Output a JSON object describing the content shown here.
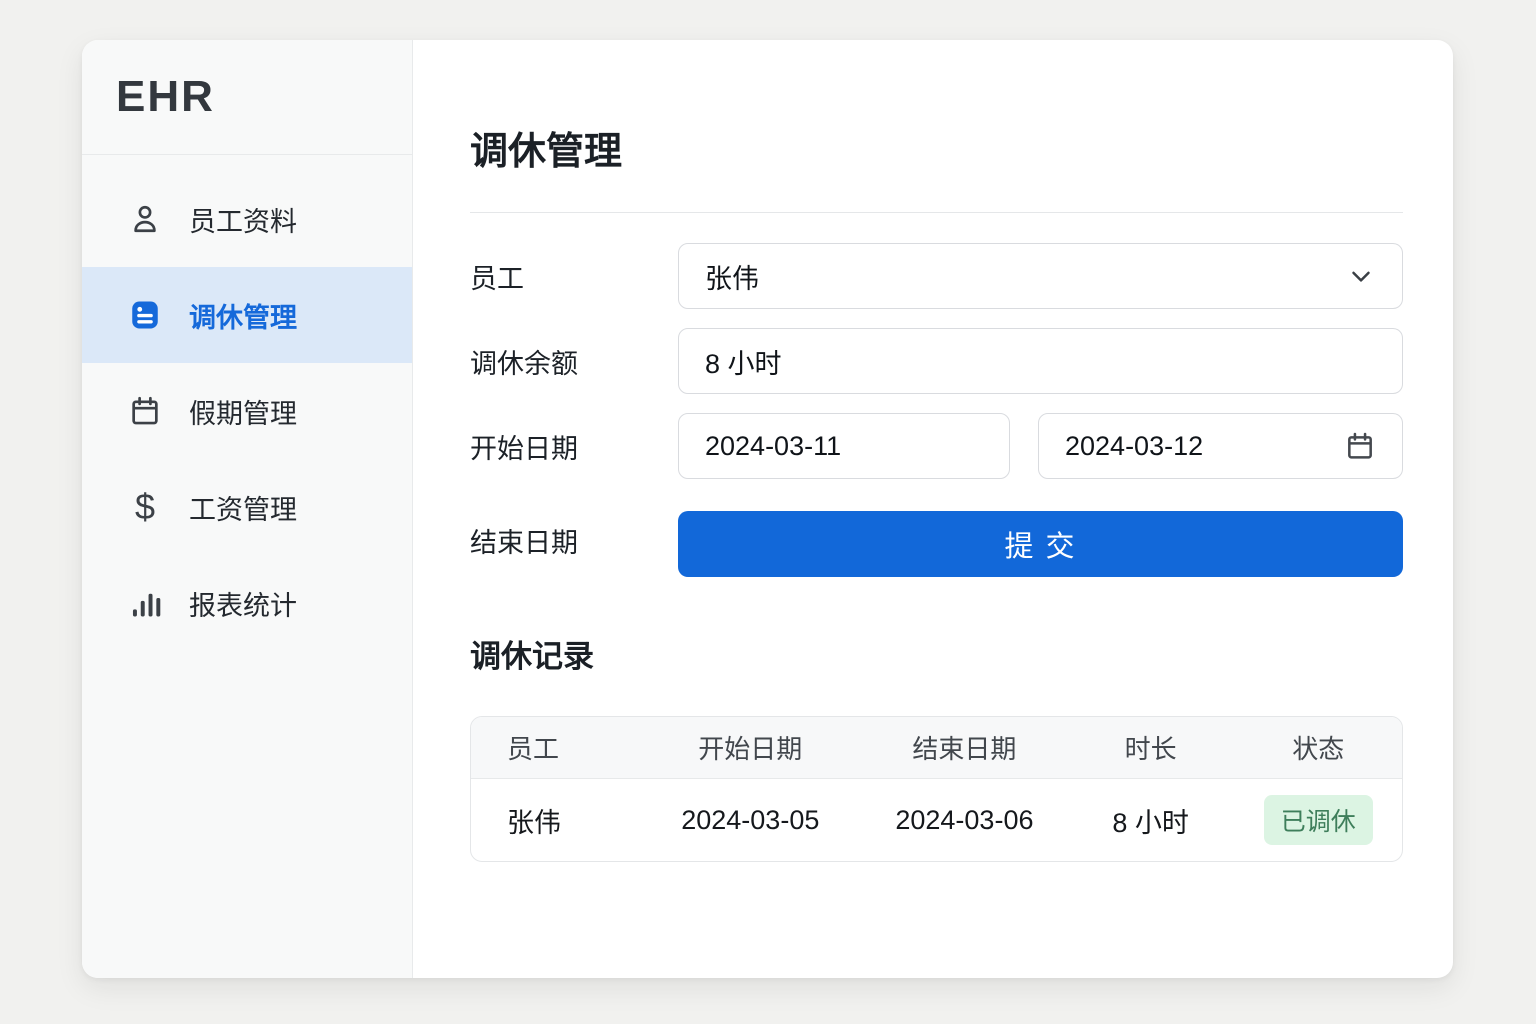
{
  "app": {
    "logo": "EHR"
  },
  "sidebar": {
    "items": [
      {
        "label": "员工资料",
        "icon": "user-icon",
        "active": false
      },
      {
        "label": "调休管理",
        "icon": "note-icon",
        "active": true
      },
      {
        "label": "假期管理",
        "icon": "calendar-icon",
        "active": false
      },
      {
        "label": "工资管理",
        "icon": "dollar-icon",
        "active": false
      },
      {
        "label": "报表统计",
        "icon": "bar-chart-icon",
        "active": false
      }
    ]
  },
  "page": {
    "title": "调休管理"
  },
  "form": {
    "employee_label": "员工",
    "employee_value": "张伟",
    "balance_label": "调休余额",
    "balance_value": "8 小时",
    "start_date_label": "开始日期",
    "start_date_value": "2024-03-11",
    "end_date_value": "2024-03-12",
    "end_date_label": "结束日期",
    "submit_label": "提 交"
  },
  "records": {
    "title": "调休记录",
    "columns": [
      "员工",
      "开始日期",
      "结束日期",
      "时长",
      "状态"
    ],
    "rows": [
      {
        "employee": "张伟",
        "start": "2024-03-05",
        "end": "2024-03-06",
        "duration": "8 小时",
        "status": "已调休"
      }
    ]
  },
  "colors": {
    "accent": "#1268d9",
    "accent_light_bg": "#dbe8f8",
    "badge_bg": "#dcf4e3",
    "badge_text": "#3e7e5b",
    "page_bg": "#f1f1ef",
    "sidebar_bg": "#f8f9f9"
  }
}
